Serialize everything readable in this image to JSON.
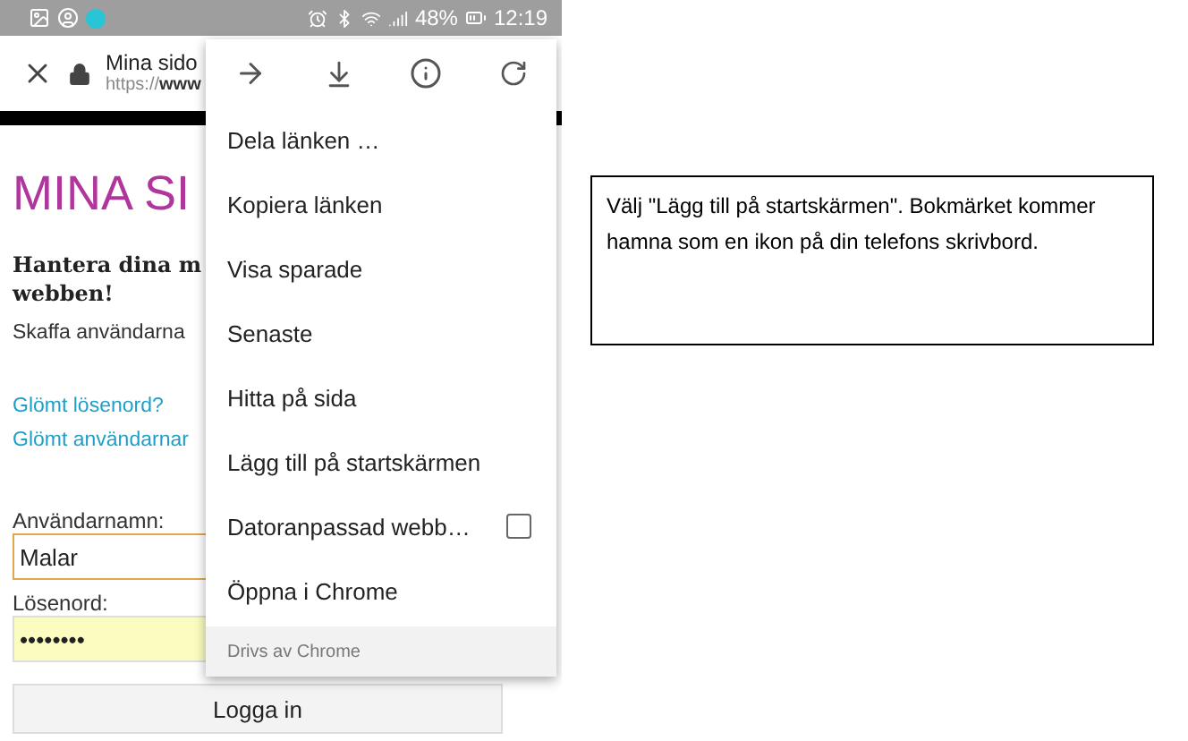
{
  "status_bar": {
    "battery": "48%",
    "time": "12:19"
  },
  "toolbar": {
    "title": "Mina sido",
    "url_prefix": "https://",
    "url_host": "www"
  },
  "page": {
    "heading": "MINA SI",
    "tagline_lines": [
      "Hantera dina m",
      "webben!"
    ],
    "intro": "Skaffa användarna",
    "links": [
      "Glömt lösenord?",
      "Glömt användarnar"
    ],
    "fields": [
      {
        "label": "Användarnamn:",
        "value": "Malar",
        "kind": "focused"
      },
      {
        "label": "Lösenord:",
        "value": "••••••••",
        "kind": "autofill"
      }
    ],
    "button": "Logga in"
  },
  "menu": {
    "items": [
      {
        "label": "Dela länken …",
        "kind": "plain"
      },
      {
        "label": "Kopiera länken",
        "kind": "plain"
      },
      {
        "label": "Visa sparade",
        "kind": "plain"
      },
      {
        "label": "Senaste",
        "kind": "plain"
      },
      {
        "label": "Hitta på sida",
        "kind": "plain"
      },
      {
        "label": "Lägg till på startskärmen",
        "kind": "plain"
      },
      {
        "label": "Datoranpassad webb…",
        "kind": "checkbox",
        "checked": false
      },
      {
        "label": "Öppna i Chrome",
        "kind": "plain"
      }
    ],
    "footer": "Drivs av Chrome"
  },
  "callout": "Välj \"Lägg till på startskärmen\". Bokmärket kommer hamna som en ikon på din telefons skrivbord."
}
